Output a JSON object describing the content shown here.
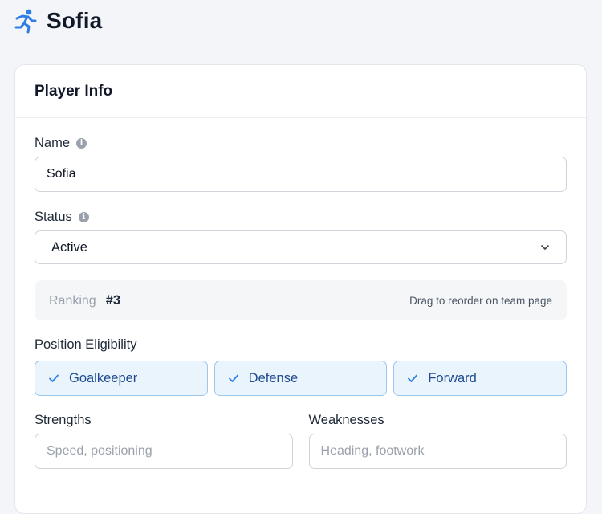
{
  "header": {
    "title": "Sofia",
    "icon": "runner-icon",
    "icon_color": "#2f7ee6"
  },
  "card": {
    "title": "Player Info"
  },
  "fields": {
    "name": {
      "label": "Name",
      "value": "Sofia"
    },
    "status": {
      "label": "Status",
      "selected": "Active"
    },
    "ranking": {
      "label": "Ranking",
      "value": "#3",
      "hint": "Drag to reorder on team page"
    },
    "positions": {
      "label": "Position Eligibility",
      "options": [
        {
          "label": "Goalkeeper",
          "checked": true
        },
        {
          "label": "Defense",
          "checked": true
        },
        {
          "label": "Forward",
          "checked": true
        }
      ]
    },
    "strengths": {
      "label": "Strengths",
      "placeholder": "Speed, positioning"
    },
    "weaknesses": {
      "label": "Weaknesses",
      "placeholder": "Heading, footwork"
    }
  },
  "colors": {
    "accent": "#2f7ee6",
    "chip_bg": "#eaf4fd",
    "chip_border": "#9cc6ec"
  }
}
